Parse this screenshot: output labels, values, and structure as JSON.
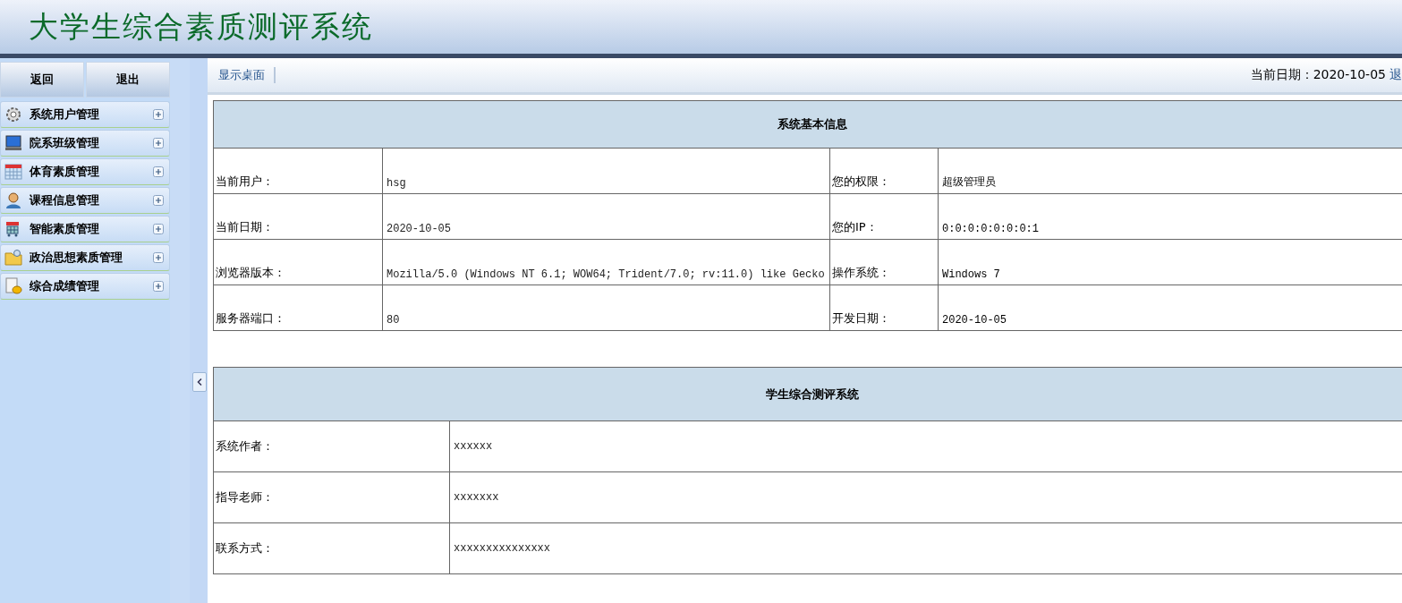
{
  "header": {
    "title": "大学生综合素质测评系统"
  },
  "sidebar": {
    "buttons": [
      "返回",
      "退出"
    ],
    "items": [
      {
        "label": "系统用户管理",
        "expanded": false
      },
      {
        "label": "院系班级管理",
        "expanded": false
      },
      {
        "label": "体育素质管理",
        "expanded": false
      },
      {
        "label": "课程信息管理",
        "expanded": false
      },
      {
        "label": "智能素质管理",
        "expanded": false
      },
      {
        "label": "政治思想素质管理",
        "expanded": false
      },
      {
        "label": "综合成绩管理",
        "expanded": false
      }
    ]
  },
  "toolbar": {
    "tab": "显示桌面",
    "date_text": "当前日期：2020-10-05",
    "link": "退"
  },
  "info_table": {
    "title": "系统基本信息",
    "rows": [
      [
        "当前用户：",
        "hsg",
        "您的权限：",
        "超级管理员"
      ],
      [
        "当前日期：",
        "2020-10-05",
        "您的IP：",
        "0:0:0:0:0:0:0:1"
      ],
      [
        "浏览器版本：",
        "Mozilla/5.0 (Windows NT 6.1; WOW64; Trident/7.0; rv:11.0) like Gecko",
        "操作系统：",
        "Windows 7"
      ],
      [
        "服务器端口：",
        "80",
        "开发日期：",
        "2020-10-05"
      ]
    ]
  },
  "about_table": {
    "title": "学生综合测评系统",
    "rows": [
      [
        "系统作者：",
        "xxxxxx"
      ],
      [
        "指导老师：",
        "xxxxxxx"
      ],
      [
        "联系方式：",
        "xxxxxxxxxxxxxxx"
      ]
    ]
  }
}
